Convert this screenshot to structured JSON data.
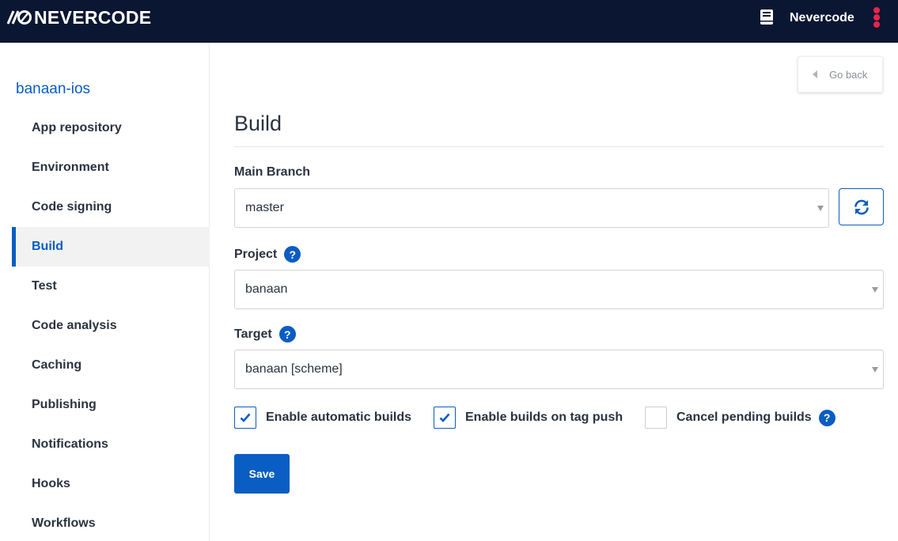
{
  "header": {
    "logo_text": "NEVERCODE",
    "account_name": "Nevercode",
    "icons": {
      "docs": "book-icon",
      "menu": "kebab-menu-icon"
    },
    "colors": {
      "bar": "#0b1633",
      "menu_dots": "#e8264b"
    }
  },
  "sidebar": {
    "project": "banaan-ios",
    "items": [
      {
        "label": "App repository",
        "active": false
      },
      {
        "label": "Environment",
        "active": false
      },
      {
        "label": "Code signing",
        "active": false
      },
      {
        "label": "Build",
        "active": true
      },
      {
        "label": "Test",
        "active": false
      },
      {
        "label": "Code analysis",
        "active": false
      },
      {
        "label": "Caching",
        "active": false
      },
      {
        "label": "Publishing",
        "active": false
      },
      {
        "label": "Notifications",
        "active": false
      },
      {
        "label": "Hooks",
        "active": false
      },
      {
        "label": "Workflows",
        "active": false
      }
    ]
  },
  "main": {
    "go_back_label": "Go back",
    "title": "Build",
    "main_branch": {
      "label": "Main Branch",
      "value": "master"
    },
    "project": {
      "label": "Project",
      "value": "banaan",
      "help": "?"
    },
    "target": {
      "label": "Target",
      "value": "banaan [scheme]",
      "help": "?"
    },
    "options": [
      {
        "label": "Enable automatic builds",
        "checked": true
      },
      {
        "label": "Enable builds on tag push",
        "checked": true
      },
      {
        "label": "Cancel pending builds",
        "checked": false,
        "help": "?"
      }
    ],
    "save_label": "Save"
  },
  "colors": {
    "accent": "#0a5dc2",
    "text": "#2a3340"
  }
}
